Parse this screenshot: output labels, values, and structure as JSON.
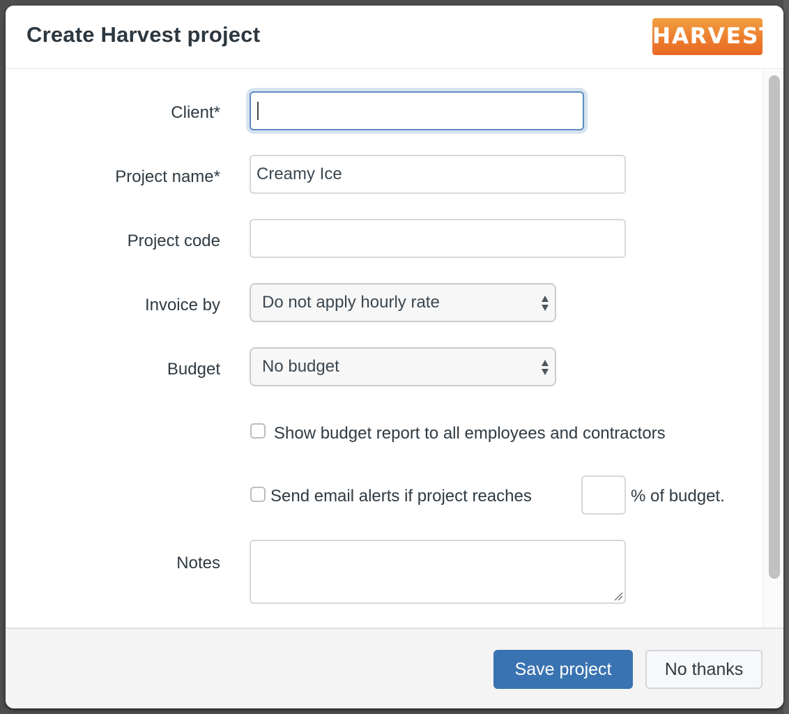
{
  "dialog": {
    "title": "Create Harvest project",
    "logo_text": "HARVEST",
    "brand_color": "#ec7a2c"
  },
  "form": {
    "client": {
      "label": "Client*",
      "value": "",
      "focused": true
    },
    "project_name": {
      "label": "Project name*",
      "value": "Creamy Ice"
    },
    "project_code": {
      "label": "Project code",
      "value": ""
    },
    "invoice_by": {
      "label": "Invoice by",
      "selected": "Do not apply hourly rate"
    },
    "budget": {
      "label": "Budget",
      "selected": "No budget"
    },
    "show_budget_report": {
      "label": "Show budget report to all employees and contractors",
      "checked": false
    },
    "email_alerts": {
      "label_before": "Send email alerts if project reaches",
      "percent_value": "",
      "label_after": "% of budget.",
      "checked": false
    },
    "notes": {
      "label": "Notes",
      "value": ""
    }
  },
  "footer": {
    "save_label": "Save project",
    "cancel_label": "No thanks",
    "primary_color": "#3a73b1"
  }
}
